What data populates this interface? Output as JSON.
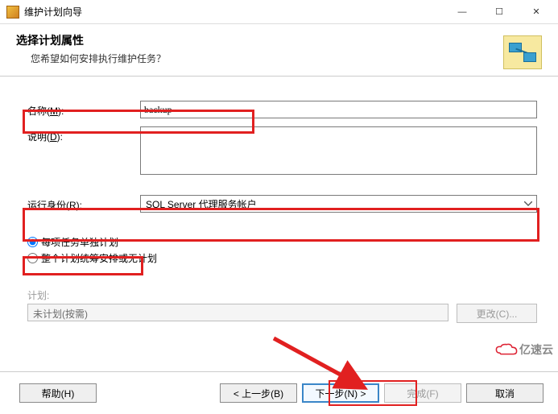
{
  "window": {
    "title": "维护计划向导",
    "minimize": "—",
    "maximize": "☐",
    "close": "✕"
  },
  "header": {
    "title": "选择计划属性",
    "subtitle": "您希望如何安排执行维护任务？"
  },
  "form": {
    "name_label": "名称(",
    "name_hot": "M",
    "name_label_tail": "):",
    "name_value": "backup",
    "desc_label": "说明(",
    "desc_hot": "D",
    "desc_label_tail": "):",
    "desc_value": "",
    "runas_label": "运行身份(",
    "runas_hot": "R",
    "runas_label_tail": "):",
    "runas_value": "SQL Server 代理服务帐户"
  },
  "radios": {
    "per_task": "每项任务单独计划",
    "single": "整个计划统筹安排或无计划"
  },
  "schedule": {
    "label": "计划:",
    "value": "未计划(按需)",
    "change_btn": "更改(C)..."
  },
  "footer": {
    "help": "帮助(H)",
    "back": "< 上一步(B)",
    "next": "下一步(N) >",
    "finish": "完成(F)",
    "cancel": "取消"
  },
  "watermark": "亿速云"
}
